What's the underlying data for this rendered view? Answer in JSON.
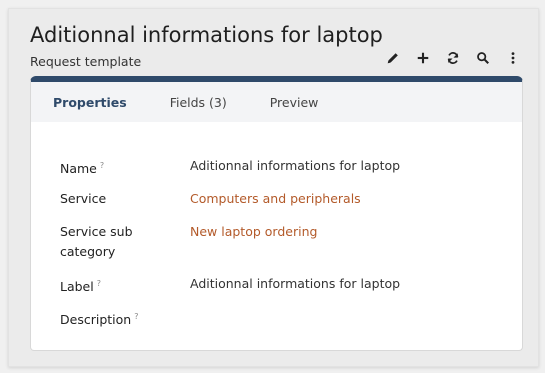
{
  "header": {
    "title": "Aditionnal informations for laptop",
    "subtitle": "Request template"
  },
  "toolbar": {
    "icons": [
      "pencil-icon",
      "plus-icon",
      "refresh-icon",
      "search-icon",
      "more-vertical-icon"
    ]
  },
  "tabs": [
    {
      "label": "Properties",
      "active": true
    },
    {
      "label": "Fields (3)",
      "active": false
    },
    {
      "label": "Preview",
      "active": false
    }
  ],
  "properties": {
    "name": {
      "label": "Name",
      "help": "?",
      "value": "Aditionnal informations for laptop"
    },
    "service": {
      "label": "Service",
      "value": "Computers and peripherals"
    },
    "service_sub_category": {
      "label": "Service sub category",
      "value": "New laptop ordering"
    },
    "label": {
      "label": "Label",
      "help": "?",
      "value": "Aditionnal informations for laptop"
    },
    "description": {
      "label": "Description",
      "help": "?",
      "value": ""
    }
  },
  "colors": {
    "accent": "#2f4a6a",
    "link": "#b35a2a"
  }
}
